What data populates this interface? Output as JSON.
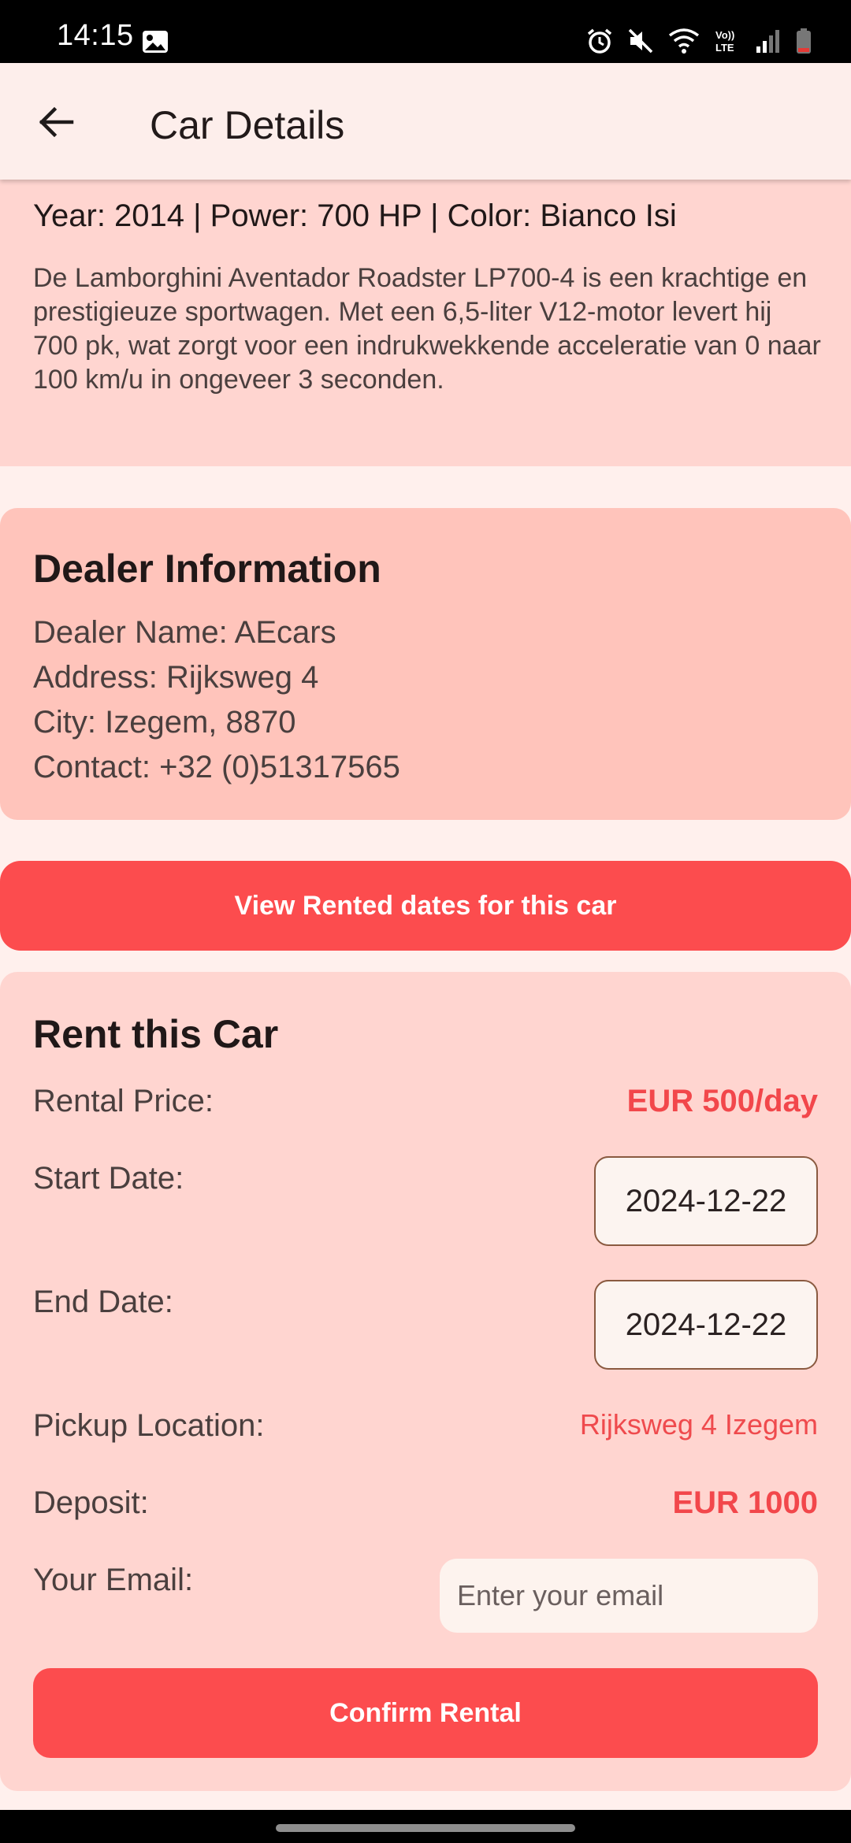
{
  "status_bar": {
    "time": "14:15",
    "icons": [
      "gallery-icon",
      "alarm-icon",
      "mute-icon",
      "wifi-icon",
      "volte-icon",
      "signal-icon",
      "battery-icon"
    ],
    "volte_label": "Vo)) LTE"
  },
  "app_bar": {
    "title": "Car Details",
    "back_icon": "arrow-left-icon"
  },
  "car": {
    "specs": "Year: 2014 | Power: 700 HP | Color: Bianco Isi",
    "description": "De Lamborghini Aventador Roadster LP700-4 is een krachtige en prestigieuze sportwagen. Met een 6,5-liter V12-motor levert hij 700 pk, wat zorgt voor een indrukwekkende acceleratie van 0 naar 100 km/u in ongeveer 3 seconden."
  },
  "dealer": {
    "title": "Dealer Information",
    "name": "Dealer Name: AEcars",
    "address": "Address: Rijksweg 4",
    "city": "City: Izegem, 8870",
    "contact": "Contact: +32 (0)51317565"
  },
  "rented_dates_button": "View Rented dates for this car",
  "rent": {
    "title": "Rent this Car",
    "price_label": "Rental Price:",
    "price_value": "EUR 500/day",
    "start_label": "Start Date:",
    "start_value": "2024-12-22",
    "end_label": "End Date:",
    "end_value": "2024-12-22",
    "pickup_label": "Pickup Location:",
    "pickup_value": "Rijksweg 4 Izegem",
    "deposit_label": "Deposit:",
    "deposit_value": "EUR 1000",
    "email_label": "Your Email:",
    "email_placeholder": "Enter your email",
    "email_value": "",
    "confirm_button": "Confirm Rental"
  },
  "colors": {
    "accent": "#fc4c4e",
    "card_pink": "#ffd5d0",
    "dealer_card": "#ffc4bb",
    "background": "#fff0ed"
  }
}
